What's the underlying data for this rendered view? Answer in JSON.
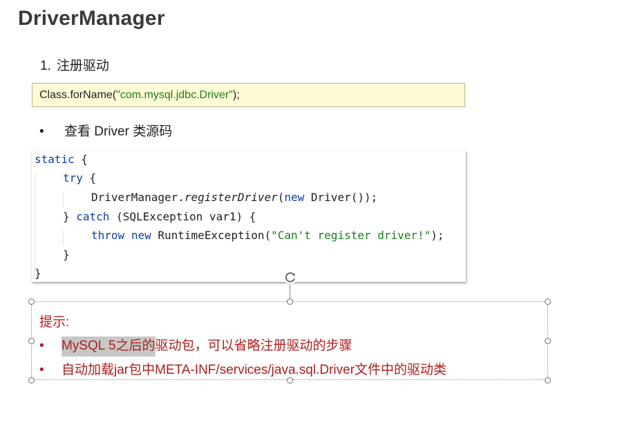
{
  "slide": {
    "title": "DriverManager",
    "step": {
      "number": "1.",
      "text": "注册驱动"
    },
    "register_code": {
      "prefix": "Class.forName(",
      "string": "\"com.mysql.jdbc.Driver\"",
      "suffix": ");"
    },
    "bullet": {
      "marker": "•",
      "text": "查看 Driver 类源码"
    },
    "source_code": {
      "line1_kw": "static",
      "line1_rest": " {",
      "line2_kw": "try",
      "line2_rest": " {",
      "line3_a": "DriverManager.",
      "line3_method": "registerDriver",
      "line3_b": "(",
      "line3_new": "new",
      "line3_c": " Driver());",
      "line4_a": "} ",
      "line4_kw": "catch",
      "line4_b": " (SQLException var1) {",
      "line5_throw": "throw",
      "line5_sp": " ",
      "line5_new": "new",
      "line5_a": " RuntimeException(",
      "line5_str": "\"Can't register driver!\"",
      "line5_b": ");",
      "line6": "}",
      "line7": "}"
    },
    "tip": {
      "title": "提示:",
      "items": [
        {
          "marker": "•",
          "highlight": "MySQL 5之后的",
          "rest": "驱动包，可以省略注册驱动的步骤"
        },
        {
          "marker": "•",
          "text": "自动加载jar包中META-INF/services/java.sql.Driver文件中的驱动类"
        }
      ]
    },
    "icons": {
      "rotate": "rotate-handle-icon"
    },
    "colors": {
      "tip_red": "#b01c1c",
      "keyword_blue": "#0b3fa8",
      "string_green": "#1a7d1a",
      "code_bg": "#fdfbd6"
    }
  }
}
